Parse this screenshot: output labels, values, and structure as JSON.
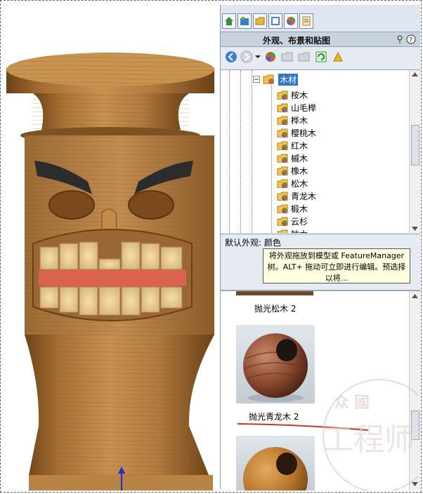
{
  "panel": {
    "title": "外观、布景和贴图"
  },
  "tree": {
    "folder": "木材",
    "items": [
      "桉木",
      "山毛榉",
      "桦木",
      "樱桃木",
      "红木",
      "槭木",
      "橡木",
      "松木",
      "青龙木",
      "椴木",
      "云杉",
      "柚木"
    ]
  },
  "description": {
    "label": "默认外观: 颜色",
    "tooltip_line1": "将外观拖放到模型或 FeatureManager",
    "tooltip_line2": "树。ALT+ 拖动可立即进行编辑。预选择以将..."
  },
  "previews": [
    {
      "caption": "抛光松木 2"
    },
    {
      "caption": "抛光青龙木 2"
    }
  ],
  "watermark": {
    "top": "众 國",
    "bottom": "工程师"
  },
  "colors": {
    "accent": "#c0392b",
    "pane_bg": "#e6ebf2",
    "wood": "#b07a3f"
  }
}
